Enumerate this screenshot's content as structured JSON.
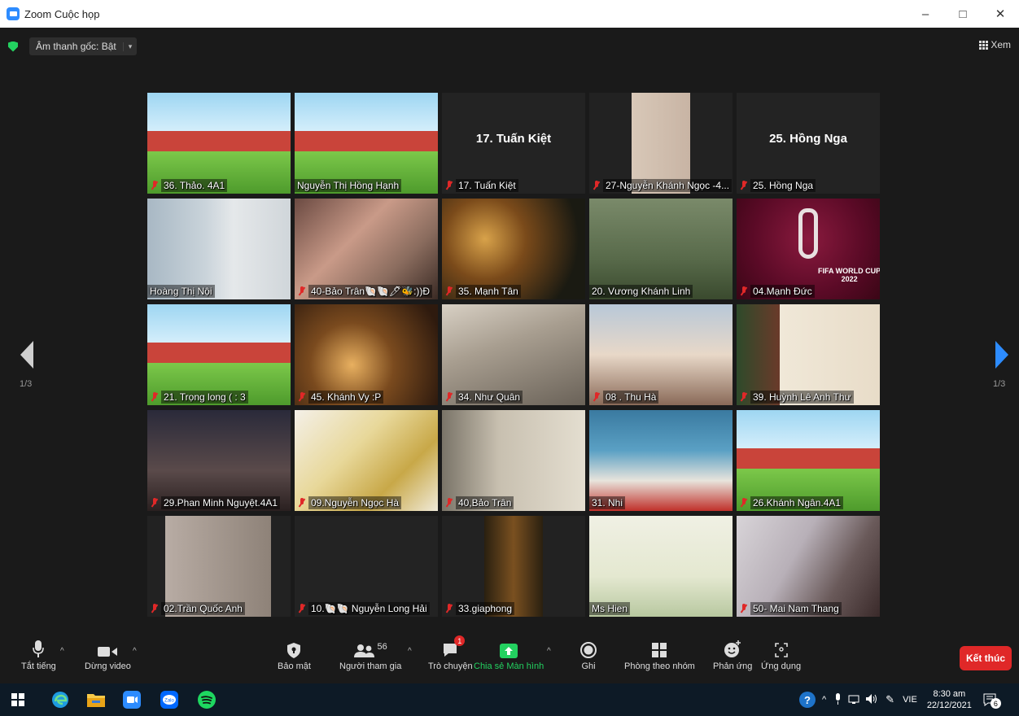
{
  "window": {
    "title": "Zoom Cuộc họp",
    "minimize": "–",
    "restore": "□",
    "close": "✕"
  },
  "meeting": {
    "audio_label": "Âm thanh gốc: Bật",
    "audio_caret": "▾",
    "view_label": "Xem",
    "page_left": "1/3",
    "page_right": "1/3"
  },
  "participants": [
    {
      "name": "36. Thảo. 4A1",
      "muted": true,
      "bg": "school"
    },
    {
      "name": "Nguyễn Thị Hồng Hạnh",
      "muted": false,
      "bg": "school"
    },
    {
      "name": "17. Tuấn Kiệt",
      "muted": true,
      "bg": "none",
      "display_name": "17. Tuấn Kiệt"
    },
    {
      "name": "27-Nguyễn Khánh Ngọc -4...",
      "muted": true,
      "bg": "camera"
    },
    {
      "name": "25. Hồng Nga",
      "muted": true,
      "bg": "none",
      "display_name": "25. Hồng Nga"
    },
    {
      "name": "Hoàng Thị Nội",
      "muted": false,
      "bg": "office",
      "active_speaker": true
    },
    {
      "name": "40-Bảo Trân🐚🐚🖊🐝:))Đ",
      "muted": true,
      "bg": "selfie"
    },
    {
      "name": "35. Mạnh Tân",
      "muted": true,
      "bg": "christmas"
    },
    {
      "name": "20. Vương Khánh Linh",
      "muted": false,
      "bg": "green"
    },
    {
      "name": "04.Mạnh Đức",
      "muted": true,
      "bg": "worldcup"
    },
    {
      "name": "21. Trọng long ( : 3",
      "muted": true,
      "bg": "school"
    },
    {
      "name": "45. Khánh Vy :P",
      "muted": true,
      "bg": "xmas-room"
    },
    {
      "name": "34. Như Quân",
      "muted": true,
      "bg": "ceiling"
    },
    {
      "name": "08 . Thu Hà",
      "muted": true,
      "bg": "window"
    },
    {
      "name": "39. Huỳnh Lê Anh Thư",
      "muted": true,
      "bg": "xmas-card"
    },
    {
      "name": "29.Phan Minh Nguyệt.4A1",
      "muted": true,
      "bg": "dark"
    },
    {
      "name": "09.Nguyễn Ngọc Hà",
      "muted": true,
      "bg": "anime"
    },
    {
      "name": "40,Bảo Trân",
      "muted": true,
      "bg": "wall"
    },
    {
      "name": "31. Nhi",
      "muted": false,
      "bg": "merry"
    },
    {
      "name": "26.Khánh Ngân.4A1",
      "muted": true,
      "bg": "school"
    },
    {
      "name": "02.Trần Quốc Anh",
      "muted": true,
      "bg": "pillow"
    },
    {
      "name": "10.🐚🐚 Nguyễn Long Hải",
      "muted": true,
      "bg": "none"
    },
    {
      "name": "33.giaphong",
      "muted": true,
      "bg": "merry-small"
    },
    {
      "name": "Ms Hien",
      "muted": false,
      "bg": "ms-hien"
    },
    {
      "name": "50- Mai Nam Thang",
      "muted": true,
      "bg": "blur"
    }
  ],
  "worldcup_text": "FIFA WORLD CUP\n2022",
  "toolbar": {
    "mute": "Tắt tiếng",
    "video": "Dừng video",
    "security": "Bảo mật",
    "participants": "Người tham gia",
    "participants_count": "56",
    "chat": "Trò chuyện",
    "chat_badge": "1",
    "share": "Chia sẻ Màn hình",
    "record": "Ghi",
    "breakout": "Phòng theo nhóm",
    "reactions": "Phản ứng",
    "apps": "Ứng dụng",
    "end": "Kết thúc"
  },
  "taskbar": {
    "language": "VIE",
    "time": "8:30 am",
    "date": "22/12/2021",
    "notif_count": "6",
    "zalo": "Zalo"
  },
  "colors": {
    "accent": "#2d8cff",
    "share_green": "#23d160",
    "end_red": "#e02828",
    "active_border": "#e4ee8a"
  }
}
